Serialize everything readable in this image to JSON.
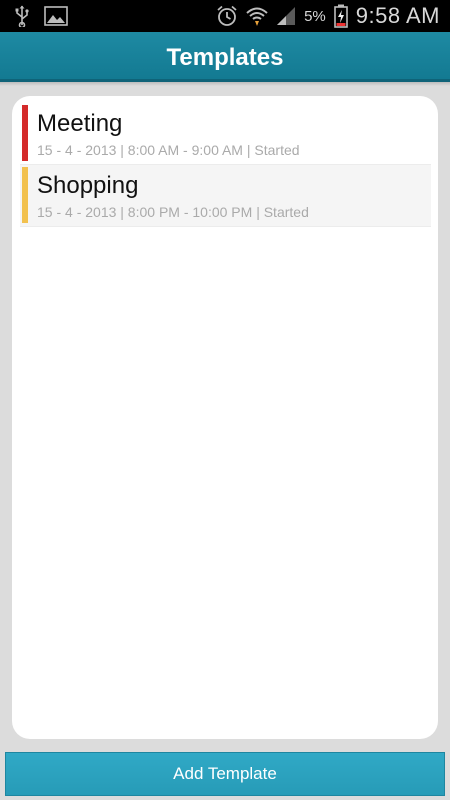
{
  "status_bar": {
    "battery_percent": "5%",
    "time": "9:58 AM",
    "icons": [
      "usb-icon",
      "image-icon",
      "alarm-icon",
      "wifi-icon",
      "signal-icon",
      "battery-charging-icon"
    ]
  },
  "header": {
    "title": "Templates"
  },
  "templates": [
    {
      "title": "Meeting",
      "meta": "15 - 4 - 2013 | 8:00 AM - 9:00 AM | Started",
      "color": "#d42a2a"
    },
    {
      "title": "Shopping",
      "meta": "15 - 4 - 2013 | 8:00 PM - 10:00 PM | Started",
      "color": "#f2c14e"
    }
  ],
  "footer": {
    "add_label": "Add Template"
  },
  "colors": {
    "header": "#1a849d",
    "button": "#2ca3bf",
    "background": "#dcdcdc"
  }
}
